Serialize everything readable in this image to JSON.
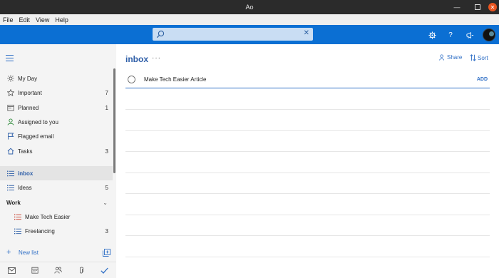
{
  "window": {
    "title": "Ao"
  },
  "menu": [
    "File",
    "Edit",
    "View",
    "Help"
  ],
  "search": {
    "value": "",
    "placeholder": ""
  },
  "colors": {
    "accent": "#0b6fd3",
    "title_blue": "#2f5fa8",
    "close": "#e9541f"
  },
  "sidebar": {
    "smart_lists": [
      {
        "label": "My Day",
        "count": "",
        "icon": "sun-icon"
      },
      {
        "label": "Important",
        "count": "7",
        "icon": "star-icon"
      },
      {
        "label": "Planned",
        "count": "1",
        "icon": "calendar-icon"
      },
      {
        "label": "Assigned to you",
        "count": "",
        "icon": "person-icon"
      },
      {
        "label": "Flagged email",
        "count": "",
        "icon": "flag-icon"
      },
      {
        "label": "Tasks",
        "count": "3",
        "icon": "home-icon"
      }
    ],
    "lists": [
      {
        "label": "inbox",
        "count": ""
      },
      {
        "label": "Ideas",
        "count": "5"
      }
    ],
    "group": {
      "label": "Work"
    },
    "group_items": [
      {
        "label": "Make Tech Easier",
        "count": ""
      },
      {
        "label": "Freelancing",
        "count": "3"
      }
    ],
    "new_list_label": "New list"
  },
  "main": {
    "list_title": "inbox",
    "share_label": "Share",
    "sort_label": "Sort",
    "add_input_value": "Make Tech Easier Article",
    "add_button": "ADD"
  }
}
